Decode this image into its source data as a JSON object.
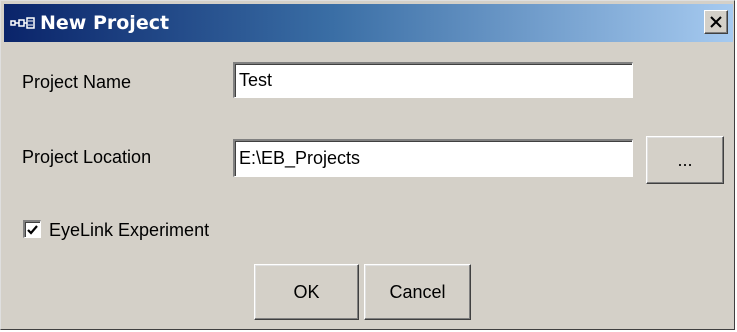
{
  "window": {
    "title": "New Project",
    "title_icon": "project-link-icon",
    "close_icon": "close-icon"
  },
  "form": {
    "project_name_label": "Project Name",
    "project_name_value": "Test",
    "project_location_label": "Project Location",
    "project_location_value": "E:\\EB_Projects",
    "browse_label": "...",
    "eyelink_checkbox_label": "EyeLink Experiment",
    "eyelink_checked": true
  },
  "buttons": {
    "ok_label": "OK",
    "cancel_label": "Cancel"
  },
  "colors": {
    "title_gradient_start": "#0a246a",
    "title_gradient_end": "#a6caf0",
    "face": "#d4d0c8"
  }
}
